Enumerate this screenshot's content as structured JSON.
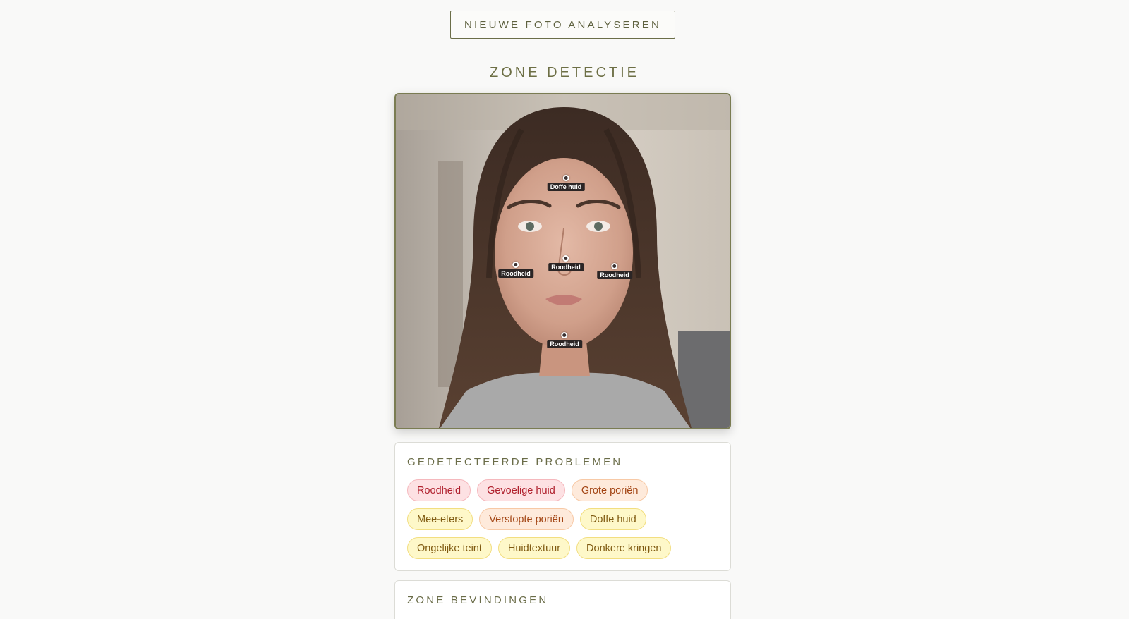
{
  "header": {
    "new_photo_button": "NIEUWE FOTO ANALYSEREN"
  },
  "zone_detection": {
    "title": "ZONE DETECTIE",
    "markers": [
      {
        "label": "Doffe huid"
      },
      {
        "label": "Roodheid"
      },
      {
        "label": "Roodheid"
      },
      {
        "label": "Roodheid"
      },
      {
        "label": "Roodheid"
      }
    ]
  },
  "problems": {
    "title": "GEDETECTEERDE PROBLEMEN",
    "items": [
      {
        "label": "Roodheid",
        "severity": "red"
      },
      {
        "label": "Gevoelige huid",
        "severity": "red"
      },
      {
        "label": "Grote poriën",
        "severity": "orange"
      },
      {
        "label": "Mee-eters",
        "severity": "yellow"
      },
      {
        "label": "Verstopte poriën",
        "severity": "orange"
      },
      {
        "label": "Doffe huid",
        "severity": "yellow"
      },
      {
        "label": "Ongelijke teint",
        "severity": "yellow"
      },
      {
        "label": "Huidtextuur",
        "severity": "yellow"
      },
      {
        "label": "Donkere kringen",
        "severity": "yellow"
      }
    ]
  },
  "zones": {
    "title": "ZONE BEVINDINGEN"
  },
  "colors": {
    "accent": "#6d6f45",
    "red": "#b0212e",
    "orange": "#a34514",
    "yellow": "#7f5a10"
  }
}
